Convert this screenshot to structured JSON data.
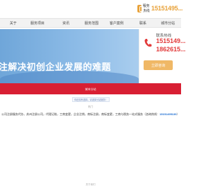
{
  "topbar": {
    "hotline_label": "服务热线",
    "hotline_number": "15151495..."
  },
  "nav": {
    "items": [
      "关于",
      "服务项目",
      "资讯",
      "服务范围",
      "客户案例",
      "联系",
      "城市分站"
    ]
  },
  "banner": {
    "title": "注解决初创企业发展的难题"
  },
  "contact": {
    "title": "联系热线",
    "number1": "1515149...",
    "number2": "1862615...",
    "consult_label": "立即咨询"
  },
  "red_band": {
    "text": "城市分站"
  },
  "notice": {
    "link_label": "你还没有选择，请选择分站服务！",
    "caption": "热门"
  },
  "description": {
    "prefix": "公司注册服务代办，苏州注册公司，代理记账，工商变更，企业注销，商标注册，商标变更，工商与税务一站式服务（咨询热线：",
    "phone": "15151495139",
    "suffix": "）"
  },
  "footer": {
    "text": "关于我们"
  },
  "colors": {
    "accent_red": "#d81f33",
    "accent_orange": "#e8a23a",
    "banner_blue": "#6fa6d9",
    "link_blue": "#1a6bd1"
  }
}
